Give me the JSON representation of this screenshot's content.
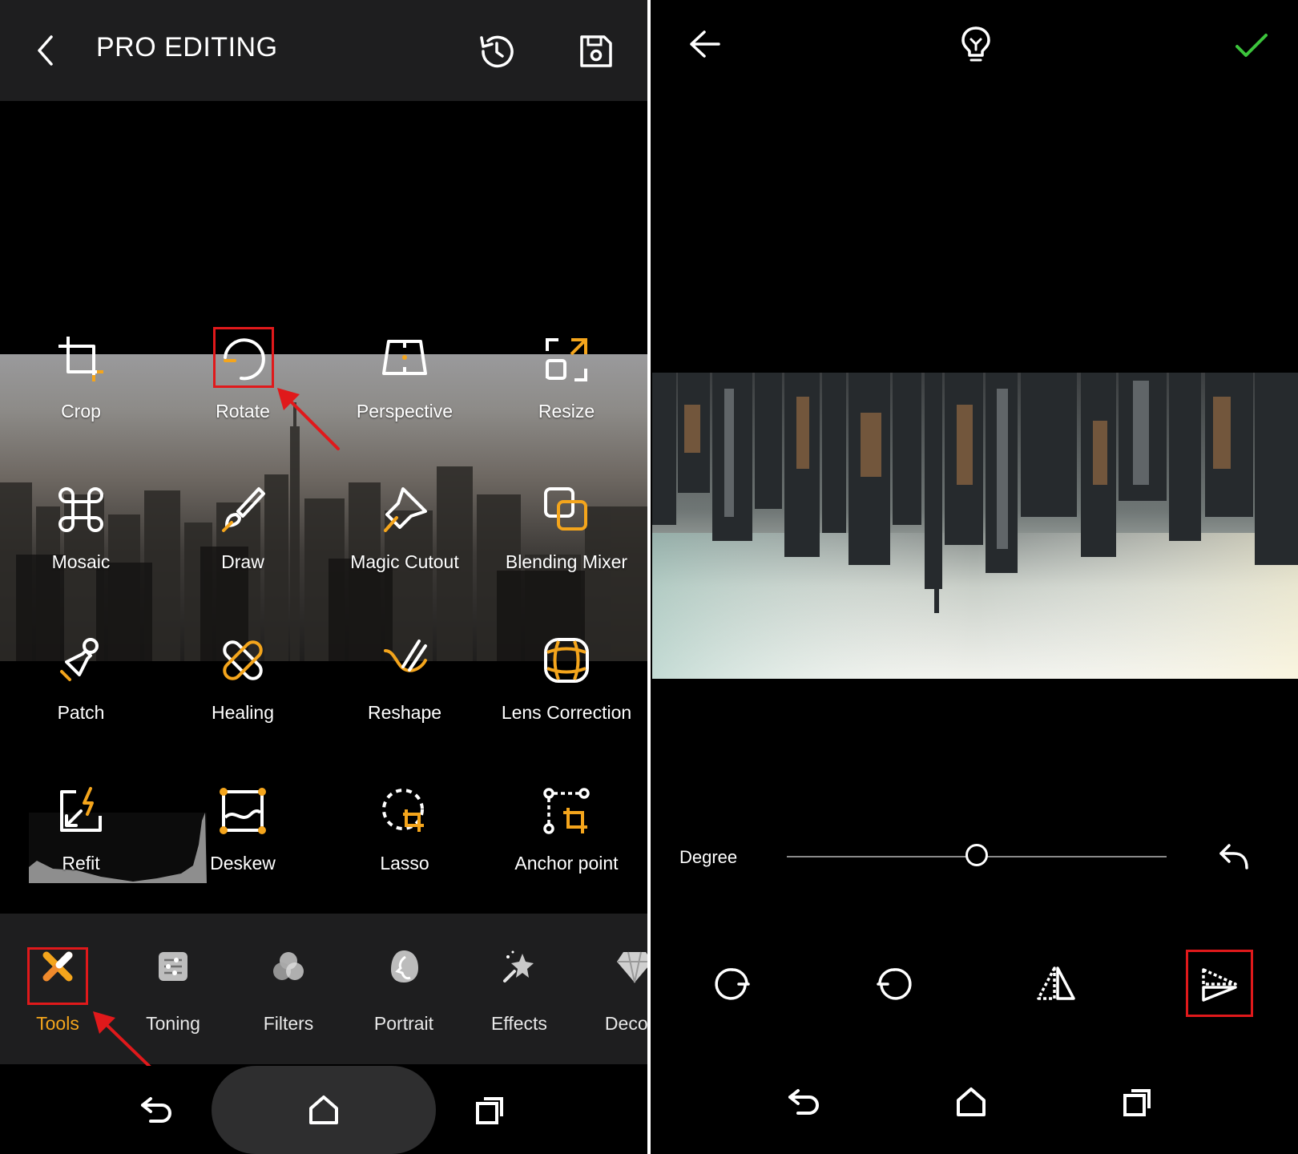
{
  "left": {
    "header": {
      "title": "PRO EDITING"
    },
    "tools": [
      {
        "label": "Crop"
      },
      {
        "label": "Rotate"
      },
      {
        "label": "Perspective"
      },
      {
        "label": "Resize"
      },
      {
        "label": "Mosaic"
      },
      {
        "label": "Draw"
      },
      {
        "label": "Magic Cutout"
      },
      {
        "label": "Blending Mixer"
      },
      {
        "label": "Patch"
      },
      {
        "label": "Healing"
      },
      {
        "label": "Reshape"
      },
      {
        "label": "Lens Correction"
      },
      {
        "label": "Refit"
      },
      {
        "label": "Deskew"
      },
      {
        "label": "Lasso"
      },
      {
        "label": "Anchor point"
      }
    ],
    "tabs": [
      {
        "label": "Tools",
        "active": true
      },
      {
        "label": "Toning"
      },
      {
        "label": "Filters"
      },
      {
        "label": "Portrait"
      },
      {
        "label": "Effects"
      },
      {
        "label": "Decora"
      }
    ]
  },
  "right": {
    "degree_label": "Degree",
    "degree_slider_fraction": 0.5
  },
  "colors": {
    "accent": "#f4a51c",
    "highlight": "#e0191b",
    "confirm": "#3cc43c",
    "bar_bg": "#1e1e1f"
  },
  "icons": [
    "back-chevron-icon",
    "history-icon",
    "save-icon",
    "crop-icon",
    "rotate-icon",
    "perspective-icon",
    "resize-icon",
    "mosaic-icon",
    "draw-brush-icon",
    "magic-cutout-icon",
    "blending-mixer-icon",
    "patch-icon",
    "healing-bandage-icon",
    "reshape-icon",
    "lens-correction-icon",
    "refit-icon",
    "deskew-icon",
    "lasso-icon",
    "anchor-point-icon",
    "tools-icon",
    "toning-icon",
    "filters-icon",
    "portrait-icon",
    "effects-icon",
    "decoration-icon",
    "back-arrow-icon",
    "lightbulb-icon",
    "checkmark-icon",
    "rotate-right-icon",
    "rotate-left-icon",
    "flip-horizontal-icon",
    "flip-vertical-icon",
    "reset-undo-icon",
    "nav-back-icon",
    "nav-home-icon",
    "nav-recents-icon"
  ]
}
